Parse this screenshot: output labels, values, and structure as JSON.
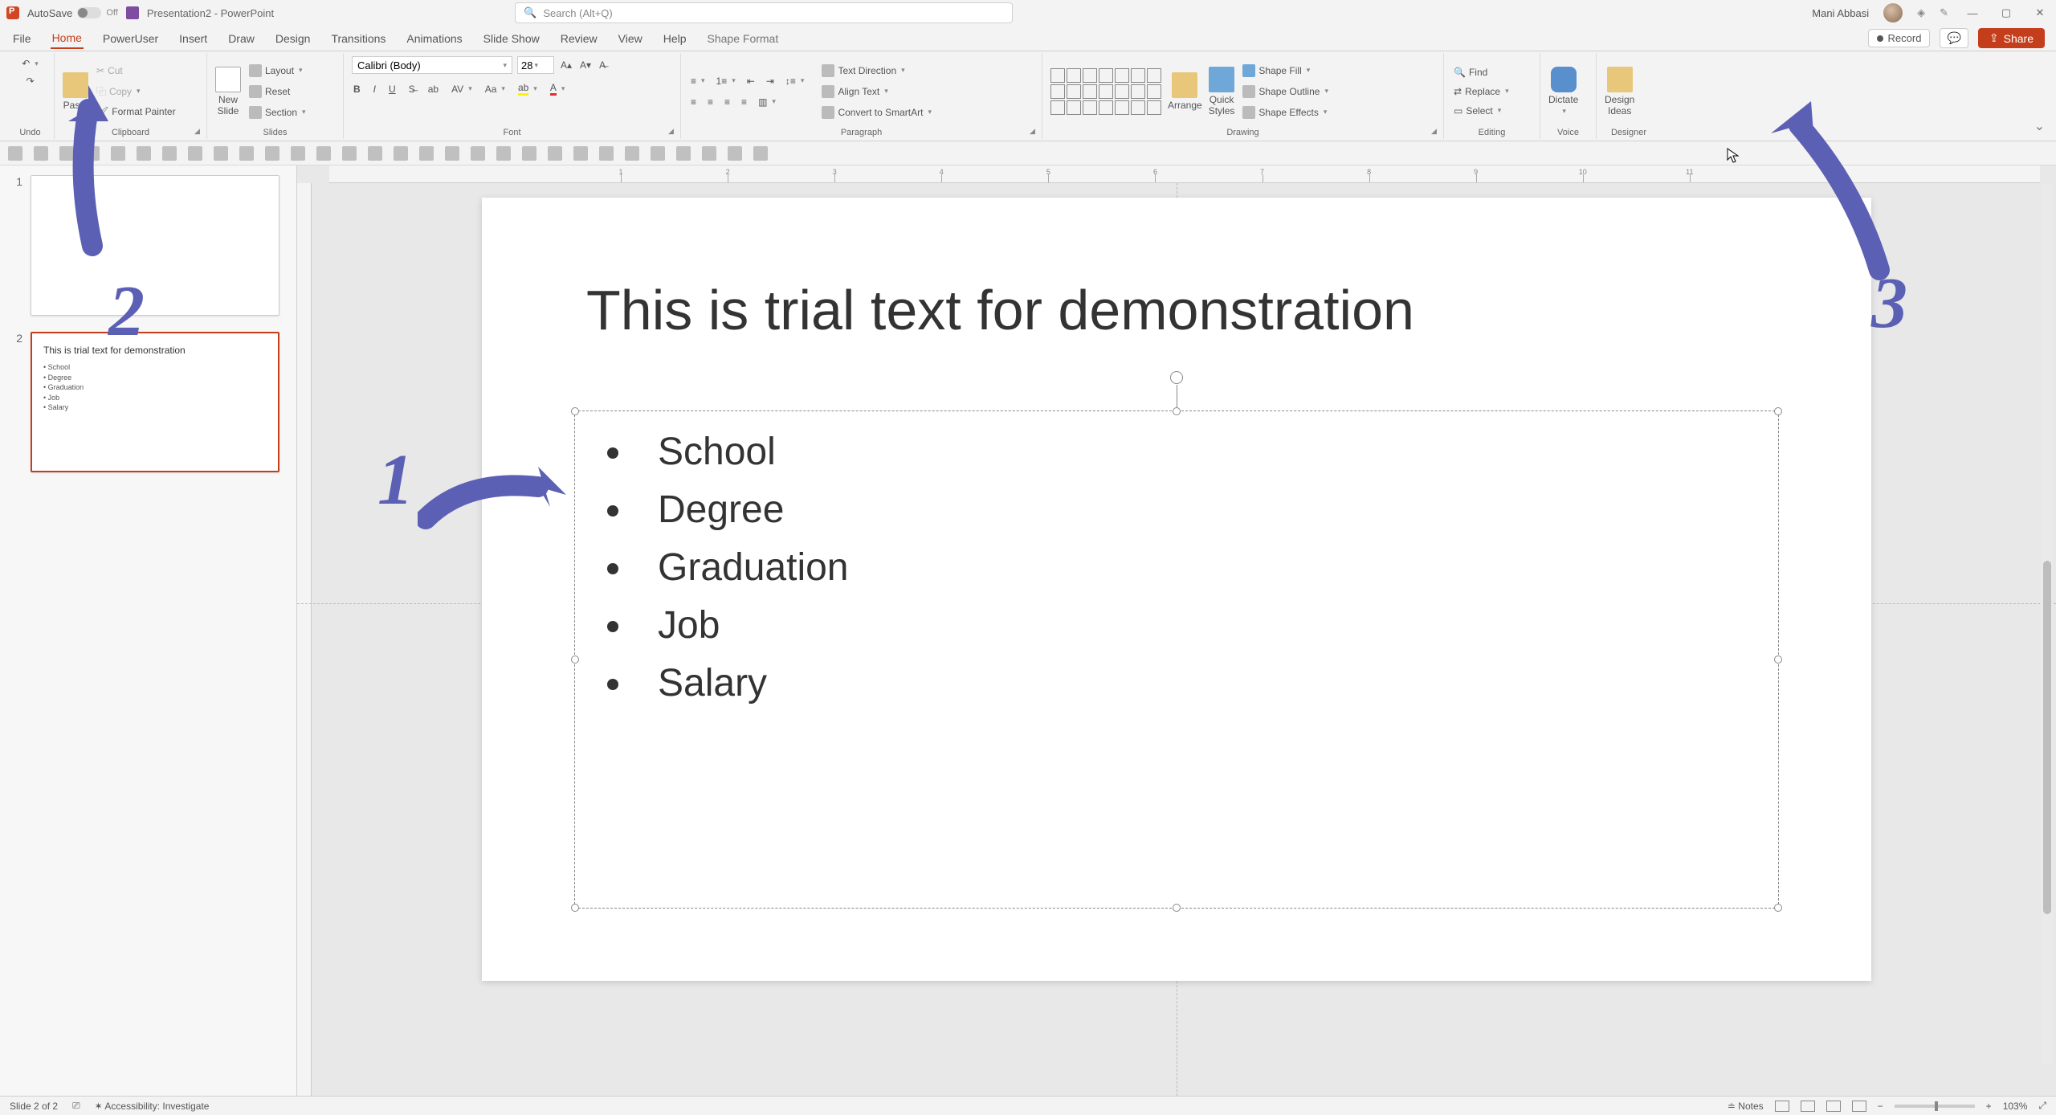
{
  "titlebar": {
    "autosave_label": "AutoSave",
    "autosave_state": "Off",
    "doc_name": "Presentation2 - PowerPoint",
    "search_placeholder": "Search (Alt+Q)",
    "user_name": "Mani Abbasi"
  },
  "tabs": {
    "file": "File",
    "home": "Home",
    "poweruser": "PowerUser",
    "insert": "Insert",
    "draw": "Draw",
    "design": "Design",
    "transitions": "Transitions",
    "animations": "Animations",
    "slideshow": "Slide Show",
    "review": "Review",
    "view": "View",
    "help": "Help",
    "shape_format": "Shape Format",
    "record": "Record",
    "share": "Share"
  },
  "ribbon": {
    "undo_group": "Undo",
    "clipboard": {
      "paste": "Paste",
      "cut": "Cut",
      "copy": "Copy",
      "format_painter": "Format Painter",
      "group": "Clipboard"
    },
    "slides": {
      "new_slide": "New\nSlide",
      "layout": "Layout",
      "reset": "Reset",
      "section": "Section",
      "group": "Slides"
    },
    "font": {
      "name": "Calibri (Body)",
      "size": "28",
      "group": "Font"
    },
    "paragraph": {
      "text_direction": "Text Direction",
      "align_text": "Align Text",
      "smartart": "Convert to SmartArt",
      "group": "Paragraph"
    },
    "drawing": {
      "arrange": "Arrange",
      "quick_styles": "Quick\nStyles",
      "shape_fill": "Shape Fill",
      "shape_outline": "Shape Outline",
      "shape_effects": "Shape Effects",
      "group": "Drawing"
    },
    "editing": {
      "find": "Find",
      "replace": "Replace",
      "select": "Select",
      "group": "Editing"
    },
    "voice": {
      "dictate": "Dictate",
      "group": "Voice"
    },
    "designer": {
      "design_ideas": "Design\nIdeas",
      "group": "Designer"
    }
  },
  "slide": {
    "title": "This is trial text for demonstration",
    "bullets": [
      "School",
      "Degree",
      "Graduation",
      "Job",
      "Salary"
    ]
  },
  "thumbnails": {
    "slide1_num": "1",
    "slide2_num": "2",
    "slide2_title": "This is trial text for demonstration",
    "slide2_items": [
      "• School",
      "• Degree",
      "• Graduation",
      "• Job",
      "• Salary"
    ]
  },
  "ruler": {
    "marks": [
      "1",
      "2",
      "3",
      "4",
      "5",
      "6",
      "7",
      "8",
      "9",
      "10",
      "11"
    ]
  },
  "statusbar": {
    "slide_of": "Slide 2 of 2",
    "accessibility": "Accessibility: Investigate",
    "notes": "Notes",
    "zoom": "103%"
  },
  "annotations": {
    "n1": "1",
    "n2": "2",
    "n3": "3"
  },
  "colors": {
    "accent": "#c43e1c",
    "anno": "#5b60b4"
  }
}
